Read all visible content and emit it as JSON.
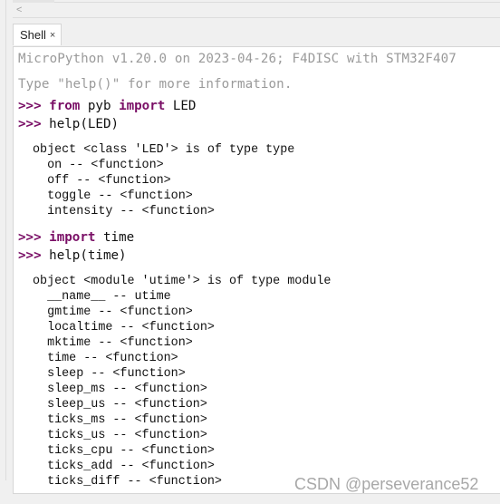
{
  "scrollbar": {
    "left_arrow": "<"
  },
  "tabs": [
    {
      "label": "Shell",
      "close": "×"
    }
  ],
  "shell": {
    "banner": [
      "MicroPython v1.20.0 on 2023-04-26; F4DISC with STM32F407",
      "Type \"help()\" for more information."
    ],
    "prompt": ">>>",
    "commands": [
      {
        "kw": "from",
        "mid": " pyb ",
        "kw2": "import",
        "rest": " LED"
      },
      {
        "text": "help(LED)"
      },
      {
        "kw": "import",
        "rest": " time"
      },
      {
        "text": "help(time)"
      }
    ],
    "output_led": [
      "object <class 'LED'> is of type type",
      "  on -- <function>",
      "  off -- <function>",
      "  toggle -- <function>",
      "  intensity -- <function>"
    ],
    "output_time": [
      "object <module 'utime'> is of type module",
      "  __name__ -- utime",
      "  gmtime -- <function>",
      "  localtime -- <function>",
      "  mktime -- <function>",
      "  time -- <function>",
      "  sleep -- <function>",
      "  sleep_ms -- <function>",
      "  sleep_us -- <function>",
      "  ticks_ms -- <function>",
      "  ticks_us -- <function>",
      "  ticks_cpu -- <function>",
      "  ticks_add -- <function>",
      "  ticks_diff -- <function>"
    ]
  },
  "watermark": "CSDN @perseverance52"
}
